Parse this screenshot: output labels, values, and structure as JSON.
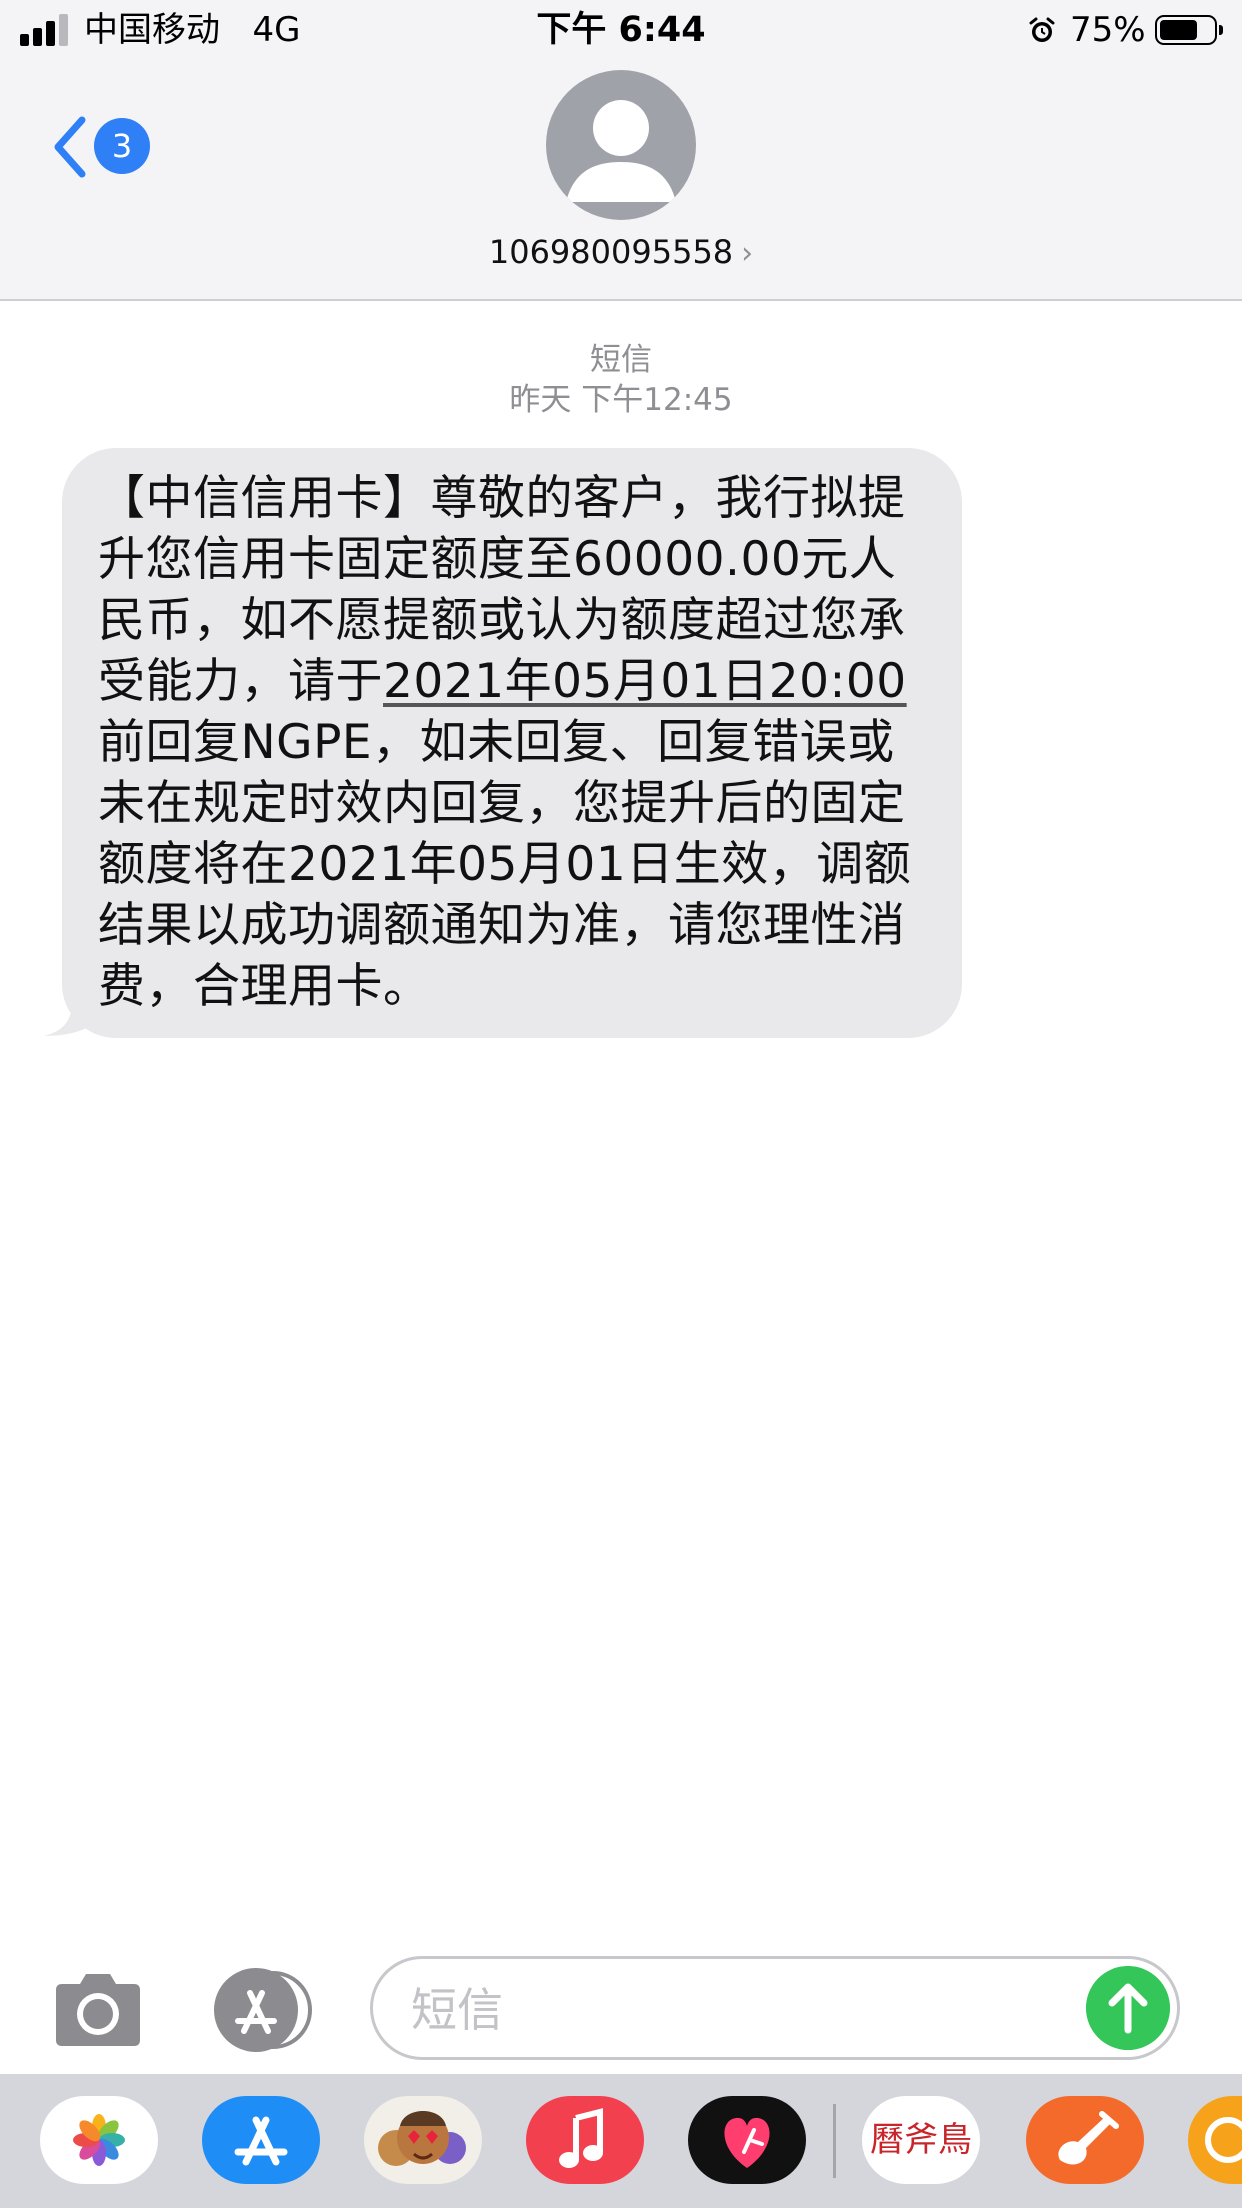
{
  "status_bar": {
    "carrier": "中国移动",
    "network": "4G",
    "time": "下午 6:44",
    "battery_percent": "75%",
    "battery_level": 0.75
  },
  "nav": {
    "back_badge": "3",
    "contact_number": "106980095558"
  },
  "conversation": {
    "service_label": "短信",
    "timestamp": "昨天 下午12:45",
    "message": {
      "part1": "【中信信用卡】尊敬的客户，我行拟提升您信用卡固定额度至60000.00元人民币，如不愿提额或认为额度超过您承受能力，请于",
      "deadline_link": "2021年05月01日20:00",
      "part2": "前回复NGPE，如未回复、回复错误或未在规定时效内回复，您提升后的固定额度将在2021年05月01日生效，调额结果以成功调额通知为准，请您理性消费，合理用卡。"
    }
  },
  "input_bar": {
    "placeholder": "短信"
  },
  "app_drawer": {
    "apps": [
      {
        "name": "photos-app-icon",
        "color": "#ffffff"
      },
      {
        "name": "app-store-app-icon",
        "color": "#1e8df5"
      },
      {
        "name": "memoji-app-icon",
        "color": "#ffffff"
      },
      {
        "name": "music-app-icon",
        "color": "#f2404f"
      },
      {
        "name": "heart-app-icon",
        "color": "#111111"
      },
      {
        "name": "seal-app-icon",
        "color": "#ffffff",
        "text": "曆斧鳥"
      },
      {
        "name": "garageband-app-icon",
        "color": "#f36a2a"
      },
      {
        "name": "orange-app-icon",
        "color": "#f7a21b"
      }
    ]
  },
  "colors": {
    "accent_blue": "#2f7ff6",
    "send_green": "#34c659",
    "bubble_gray": "#e9e9eb"
  }
}
